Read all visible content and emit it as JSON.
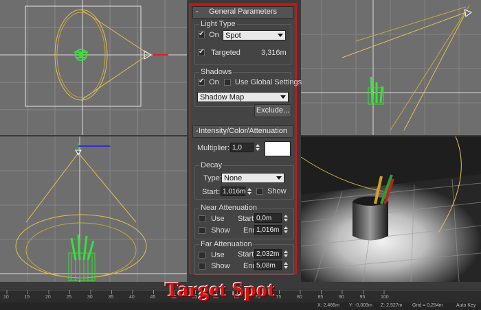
{
  "general_parameters": {
    "title": "General Parameters",
    "collapse_glyph": "-",
    "light_type": {
      "group_title": "Light Type",
      "on_label": "On",
      "on_checked": true,
      "type_value": "Spot",
      "targeted_label": "Targeted",
      "targeted_checked": true,
      "target_distance": "3,316m"
    },
    "shadows": {
      "group_title": "Shadows",
      "on_label": "On",
      "on_checked": true,
      "global_label": "Use Global Settings",
      "global_checked": false,
      "shadow_type": "Shadow Map",
      "exclude_label": "Exclude..."
    }
  },
  "intensity": {
    "title": "Intensity/Color/Attenuation",
    "collapse_glyph": "-",
    "multiplier_label": "Multiplier:",
    "multiplier_value": "1,0",
    "color": "#ffffff",
    "decay": {
      "group_title": "Decay",
      "type_label": "Type:",
      "type_value": "None",
      "start_label": "Start:",
      "start_value": "1,016m",
      "show_label": "Show",
      "show_checked": false
    },
    "near": {
      "group_title": "Near Attenuation",
      "use_label": "Use",
      "show_label": "Show",
      "start_label": "Start:",
      "start_value": "0,0m",
      "end_label": "End:",
      "end_value": "1,016m"
    },
    "far": {
      "group_title": "Far Attenuation",
      "use_label": "Use",
      "show_label": "Show",
      "start_label": "Start:",
      "start_value": "2,032m",
      "end_label": "End:",
      "end_value": "5,08m"
    }
  },
  "caption": "Target Spot",
  "timeline": {
    "ticks": [
      "10",
      "15",
      "20",
      "25",
      "30",
      "35",
      "40",
      "45",
      "50",
      "55",
      "60",
      "65",
      "70",
      "75",
      "80",
      "85",
      "90",
      "95",
      "100"
    ]
  },
  "status": {
    "x": "X: 2,466m",
    "y": "Y: -0,003m",
    "z": "Z: 2,527m",
    "grid": "Grid = 0,254m",
    "autokey": "Auto Key"
  },
  "colors": {
    "panel_border": "#d21414",
    "caption": "#e01010",
    "wire_yellow": "#e8c24a",
    "object_green": "#36e236"
  }
}
